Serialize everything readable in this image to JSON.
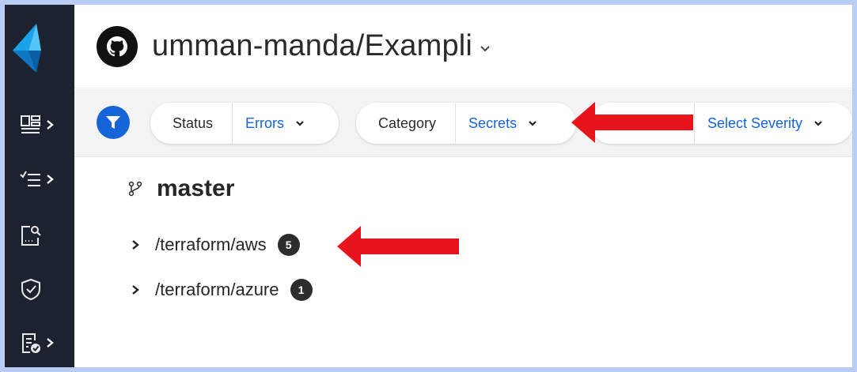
{
  "header": {
    "repo_title": "umman-manda/Exampli",
    "github_icon": "github-icon"
  },
  "sidebar": {
    "items": [
      {
        "name": "dashboard-icon",
        "has_chevron": true
      },
      {
        "name": "list-icon",
        "has_chevron": true
      },
      {
        "name": "search-document-icon",
        "has_chevron": false
      },
      {
        "name": "shield-check-icon",
        "has_chevron": false
      },
      {
        "name": "report-check-icon",
        "has_chevron": true
      }
    ]
  },
  "filters": {
    "status": {
      "label": "Status",
      "value": "Errors"
    },
    "category": {
      "label": "Category",
      "value": "Secrets"
    },
    "severity": {
      "label": "",
      "value": "Select Severity"
    }
  },
  "tree": {
    "branch": "master",
    "rows": [
      {
        "path": "/terraform/aws",
        "count": "5"
      },
      {
        "path": "/terraform/azure",
        "count": "1"
      }
    ]
  },
  "colors": {
    "accent": "#1565d8",
    "sidebar_bg": "#1c2230",
    "annotation_arrow": "#e8141b",
    "frame_border": "#b9ccf6"
  }
}
